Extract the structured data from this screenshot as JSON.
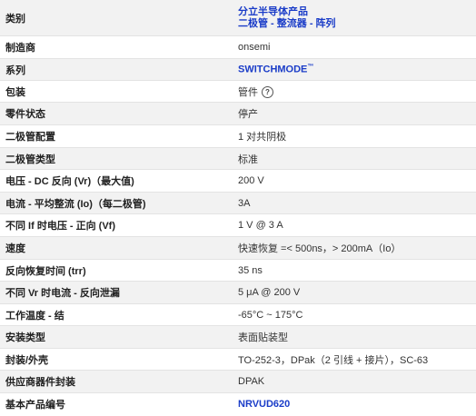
{
  "rows": [
    {
      "label": "类别",
      "value_lines": [
        "分立半导体产品",
        "二极管 - 整流器 - 阵列"
      ],
      "type": "category"
    },
    {
      "label": "制造商",
      "value": "onsemi"
    },
    {
      "label": "系列",
      "value": "SWITCHMODE",
      "tm": "™",
      "type": "link"
    },
    {
      "label": "包装",
      "value": "管件",
      "help_icon": "question-circle-icon"
    },
    {
      "label": "零件状态",
      "value": "停产"
    },
    {
      "label": "二极管配置",
      "value": "1 对共阴极"
    },
    {
      "label": "二极管类型",
      "value": "标准"
    },
    {
      "label": "电压 - DC 反向 (Vr)（最大值)",
      "value": "200 V"
    },
    {
      "label": "电流 - 平均整流 (Io)（每二极管)",
      "value": "3A"
    },
    {
      "label": "不同 If 时电压 - 正向 (Vf)",
      "value": "1 V @ 3 A"
    },
    {
      "label": "速度",
      "value": "快速恢复 =< 500ns，> 200mA（Io）"
    },
    {
      "label": "反向恢复时间 (trr)",
      "value": "35 ns"
    },
    {
      "label": "不同 Vr 时电流 - 反向泄漏",
      "value": "5 μA @ 200 V"
    },
    {
      "label": "工作温度 - 结",
      "value": "-65°C ~ 175°C"
    },
    {
      "label": "安装类型",
      "value": "表面贴装型"
    },
    {
      "label": "封装/外壳",
      "value": "TO-252-3，DPak（2 引线 + 接片），SC-63"
    },
    {
      "label": "供应商器件封装",
      "value": "DPAK"
    },
    {
      "label": "基本产品编号",
      "value": "NRVUD620",
      "type": "link"
    }
  ],
  "colors": {
    "link": "#1a3cc8",
    "stripe": "#f2f2f2",
    "border": "#e3e3e3"
  }
}
